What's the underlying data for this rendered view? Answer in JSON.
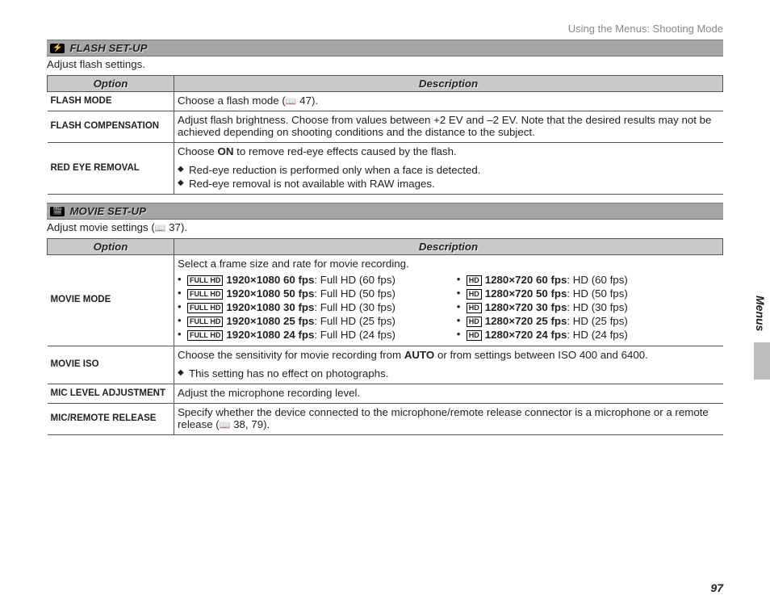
{
  "header": {
    "path": "Using the Menus: Shooting Mode"
  },
  "sections": [
    {
      "icon_glyph": "⚡",
      "title": "FLASH SET-UP",
      "description": "Adjust flash settings.",
      "headers": {
        "option": "Option",
        "description": "Description"
      },
      "rows": [
        {
          "option": "FLASH MODE",
          "type": "plain",
          "text_before": "Choose a flash mode (",
          "page_ref": " 47).",
          "notes": []
        },
        {
          "option": "FLASH COMPENSATION",
          "type": "plain",
          "text_before": "Adjust flash brightness.  Choose from values between +2 EV and –2 EV.  Note that the desired results may not be achieved depending on shooting conditions and the distance to the subject.",
          "page_ref": "",
          "notes": []
        },
        {
          "option": "RED EYE REMOVAL",
          "type": "plain_notes",
          "lead": "Choose ",
          "bold": "ON",
          "tail": " to remove red-eye effects caused by the flash.",
          "notes": [
            "Red-eye reduction is performed only when a face is detected.",
            "Red-eye removal is not available with RAW images."
          ]
        }
      ]
    },
    {
      "icon_glyph": "🎬",
      "title": "MOVIE SET-UP",
      "description_pre": "Adjust movie settings (",
      "description_ref": " 37).",
      "headers": {
        "option": "Option",
        "description": "Description"
      },
      "rows": [
        {
          "option": "MOVIE MODE",
          "type": "modes",
          "intro": "Select a frame size and rate for movie recording.",
          "left_modes": [
            {
              "badge": "FULL HD",
              "bold": "1920×1080 60 fps",
              "desc": ": Full HD (60 fps)"
            },
            {
              "badge": "FULL HD",
              "bold": "1920×1080 50 fps",
              "desc": ": Full HD (50 fps)"
            },
            {
              "badge": "FULL HD",
              "bold": "1920×1080 30 fps",
              "desc": ": Full HD (30 fps)"
            },
            {
              "badge": "FULL HD",
              "bold": "1920×1080 25 fps",
              "desc": ": Full HD (25 fps)"
            },
            {
              "badge": "FULL HD",
              "bold": "1920×1080 24 fps",
              "desc": ": Full HD (24 fps)"
            }
          ],
          "right_modes": [
            {
              "badge": "HD",
              "bold": "1280×720 60 fps",
              "desc": ": HD (60 fps)"
            },
            {
              "badge": "HD",
              "bold": "1280×720 50 fps",
              "desc": ": HD (50 fps)"
            },
            {
              "badge": "HD",
              "bold": "1280×720 30 fps",
              "desc": ": HD (30 fps)"
            },
            {
              "badge": "HD",
              "bold": "1280×720 25 fps",
              "desc": ": HD (25 fps)"
            },
            {
              "badge": "HD",
              "bold": "1280×720 24 fps",
              "desc": ": HD (24 fps)"
            }
          ]
        },
        {
          "option": "MOVIE ISO",
          "type": "plain_notes2",
          "lead": "Choose the sensitivity for movie recording from ",
          "bold": "AUTO",
          "tail": " or from settings between ISO 400 and 6400.",
          "notes": [
            "This setting has no effect on photographs."
          ]
        },
        {
          "option": "MIC LEVEL ADJUSTMENT",
          "type": "plain",
          "text_before": "Adjust the microphone recording level.",
          "page_ref": "",
          "notes": []
        },
        {
          "option": "MIC/REMOTE RELEASE",
          "type": "plain",
          "text_before": "Specify whether the device connected to the microphone/remote release connector is a microphone or a remote release (",
          "page_ref": " 38, 79).",
          "notes": []
        }
      ]
    }
  ],
  "side_tab": "Menus",
  "page_number": "97"
}
